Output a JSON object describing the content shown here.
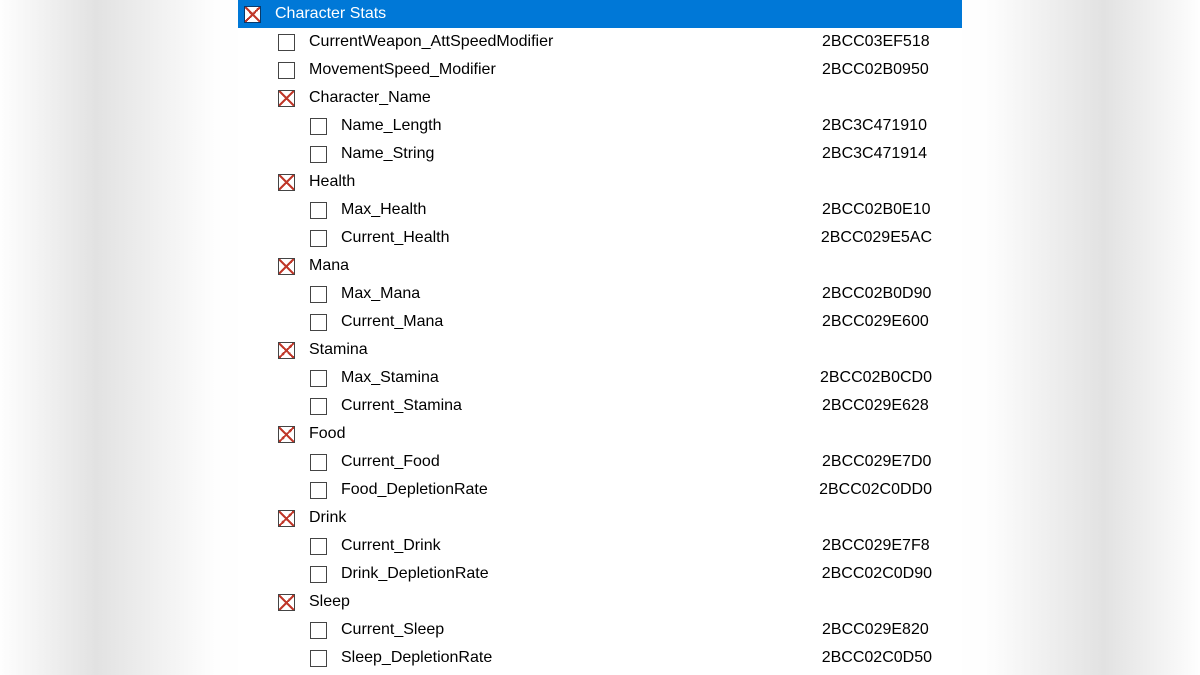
{
  "tree": {
    "root": {
      "label": "Character Stats",
      "checked": true,
      "selected": true,
      "indent": 0,
      "address": "",
      "children": [
        {
          "label": "CurrentWeapon_AttSpeedModifier",
          "checked": false,
          "indent": 1,
          "address": "2BCC03EF518"
        },
        {
          "label": "MovementSpeed_Modifier",
          "checked": false,
          "indent": 1,
          "address": "2BCC02B0950"
        },
        {
          "label": "Character_Name",
          "checked": true,
          "indent": 1,
          "address": "",
          "children": [
            {
              "label": "Name_Length",
              "checked": false,
              "indent": 2,
              "address": "2BC3C471910"
            },
            {
              "label": "Name_String",
              "checked": false,
              "indent": 2,
              "address": "2BC3C471914"
            }
          ]
        },
        {
          "label": "Health",
          "checked": true,
          "indent": 1,
          "address": "",
          "children": [
            {
              "label": "Max_Health",
              "checked": false,
              "indent": 2,
              "address": "2BCC02B0E10"
            },
            {
              "label": "Current_Health",
              "checked": false,
              "indent": 2,
              "address": "2BCC029E5AC"
            }
          ]
        },
        {
          "label": "Mana",
          "checked": true,
          "indent": 1,
          "address": "",
          "children": [
            {
              "label": "Max_Mana",
              "checked": false,
              "indent": 2,
              "address": "2BCC02B0D90"
            },
            {
              "label": "Current_Mana",
              "checked": false,
              "indent": 2,
              "address": "2BCC029E600"
            }
          ]
        },
        {
          "label": "Stamina",
          "checked": true,
          "indent": 1,
          "address": "",
          "children": [
            {
              "label": "Max_Stamina",
              "checked": false,
              "indent": 2,
              "address": "2BCC02B0CD0"
            },
            {
              "label": "Current_Stamina",
              "checked": false,
              "indent": 2,
              "address": "2BCC029E628"
            }
          ]
        },
        {
          "label": "Food",
          "checked": true,
          "indent": 1,
          "address": "",
          "children": [
            {
              "label": "Current_Food",
              "checked": false,
              "indent": 2,
              "address": "2BCC029E7D0"
            },
            {
              "label": "Food_DepletionRate",
              "checked": false,
              "indent": 2,
              "address": "2BCC02C0DD0"
            }
          ]
        },
        {
          "label": "Drink",
          "checked": true,
          "indent": 1,
          "address": "",
          "children": [
            {
              "label": "Current_Drink",
              "checked": false,
              "indent": 2,
              "address": "2BCC029E7F8"
            },
            {
              "label": "Drink_DepletionRate",
              "checked": false,
              "indent": 2,
              "address": "2BCC02C0D90"
            }
          ]
        },
        {
          "label": "Sleep",
          "checked": true,
          "indent": 1,
          "address": "",
          "children": [
            {
              "label": "Current_Sleep",
              "checked": false,
              "indent": 2,
              "address": "2BCC029E820"
            },
            {
              "label": "Sleep_DepletionRate",
              "checked": false,
              "indent": 2,
              "address": "2BCC02C0D50"
            }
          ]
        }
      ]
    }
  }
}
